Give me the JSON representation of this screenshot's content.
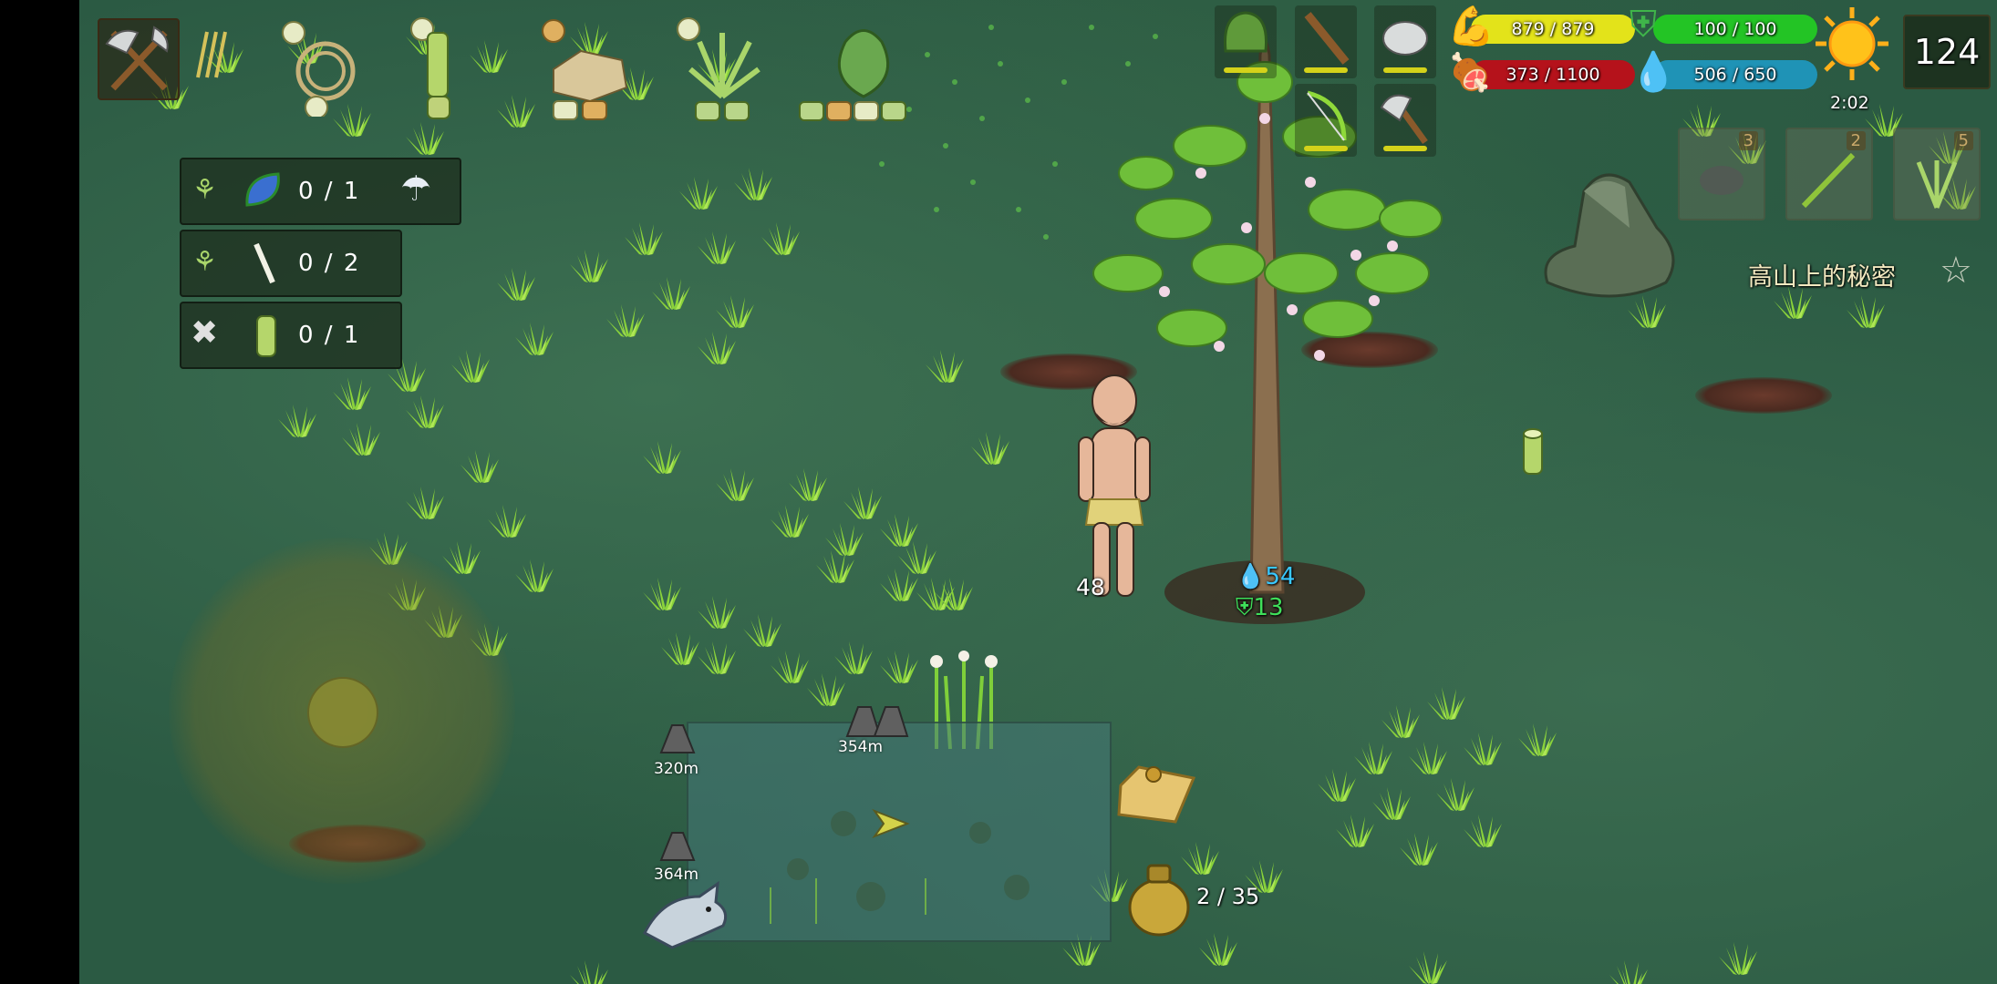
{
  "hud": {
    "top_right_counter": "124",
    "day_time": "2:02",
    "stats": {
      "strength": "879 / 879",
      "armor": "100 / 100",
      "food": "373 / 1100",
      "water": "506 / 650"
    }
  },
  "quests": [
    {
      "count": "0 / 1"
    },
    {
      "count": "0 / 2"
    },
    {
      "count": "0 / 1"
    }
  ],
  "inventory_slots": [
    {
      "count": "3"
    },
    {
      "count": "2"
    },
    {
      "count": "5"
    }
  ],
  "quest_title": "高山上的秘密",
  "world": {
    "player_number": "48",
    "tree_water": "54",
    "tree_armor": "13"
  },
  "map": {
    "pins": [
      {
        "label": "320m"
      },
      {
        "label": "354m"
      },
      {
        "label": "364m"
      }
    ]
  },
  "bag": {
    "capacity": "2 / 35"
  },
  "colors": {
    "strength_bar": "#e3e31a",
    "armor_bar": "#23c425",
    "food_bar": "#b5121b",
    "water_bar": "#1f93b6",
    "grass": "#8fd93a",
    "ground": "#2b5a43"
  }
}
